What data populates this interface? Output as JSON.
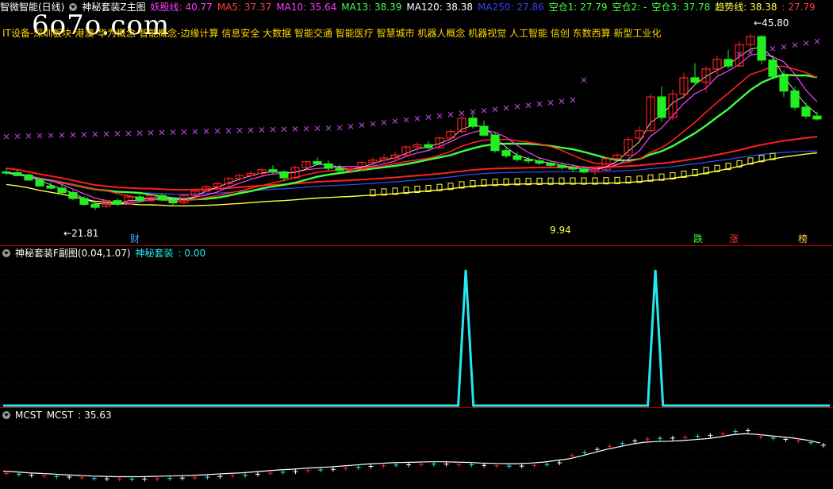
{
  "main_header": {
    "title": "智微智能(日线)",
    "indicator_name": "神秘套装Z主图",
    "items": [
      {
        "label": "妖股线",
        "value": "40.77",
        "color": "#ff3cff"
      },
      {
        "label": "MA5",
        "value": "37.37",
        "color": "#ff3c3c"
      },
      {
        "label": "MA10",
        "value": "35.64",
        "color": "#ff3cff"
      },
      {
        "label": "MA13",
        "value": "38.39",
        "color": "#4cff4c"
      },
      {
        "label": "MA120",
        "value": "38.38",
        "color": "#ffffff"
      },
      {
        "label": "MA250",
        "value": "27.86",
        "color": "#3c3cff"
      },
      {
        "label": "空仓1",
        "value": "27.79",
        "color": "#44ff44"
      },
      {
        "label": "空仓2",
        "value": "-",
        "color": "#44ff44"
      },
      {
        "label": "空仓3",
        "value": "37.78",
        "color": "#44ff44"
      },
      {
        "label": "趋势线",
        "value": "38.38",
        "color": "#ffff44"
      },
      {
        "label": "",
        "value": "27.79",
        "color": "#ff3c3c"
      }
    ]
  },
  "concepts": "IT设备-深圳板块-港澳-华为概念-智能概念-边缘计算 信息安全 大数据 智能交通 智能医疗 智慧城市 机器人概念 机器视觉 人工智能 信创 东数西算 新型工业化",
  "watermark": "6o7o.com",
  "price_labels": {
    "high": "45.80",
    "low": "21.81",
    "mid": "9.94"
  },
  "markers": {
    "cai": "财",
    "die": "跌",
    "zhang": "涨",
    "bang": "榜"
  },
  "sub1": {
    "title": "神秘套装F副图(0.04,1.07)",
    "label": "神秘套装",
    "value": "0.00"
  },
  "sub2": {
    "title": "MCST",
    "label": "MCST",
    "value": "35.63"
  },
  "colors": {
    "up": "#ff2020",
    "down": "#22ee22",
    "grid": "#7a0000",
    "cyan": "#22e8f0",
    "cross": "#b040d0",
    "ma_red": "#ff2020",
    "ma_blue": "#3050ff",
    "ma_yellow": "#ffff40",
    "ma_white": "#ffffff",
    "ma_magenta": "#ff40ff",
    "ma_green": "#40ff40"
  },
  "chart_data": [
    {
      "type": "candlestick",
      "title": "智微智能(日线)",
      "ylim": [
        18,
        48
      ],
      "candles": [
        [
          27.0,
          27.5,
          26.6,
          26.9
        ],
        [
          26.9,
          27.3,
          26.4,
          26.5
        ],
        [
          26.6,
          26.8,
          25.8,
          25.9
        ],
        [
          25.9,
          26.2,
          25.0,
          25.1
        ],
        [
          25.1,
          25.6,
          24.6,
          24.8
        ],
        [
          24.8,
          25.2,
          24.0,
          24.2
        ],
        [
          24.2,
          24.5,
          23.2,
          23.4
        ],
        [
          23.4,
          23.7,
          22.4,
          22.6
        ],
        [
          22.6,
          23.0,
          21.81,
          22.2
        ],
        [
          22.3,
          23.3,
          22.1,
          23.1
        ],
        [
          23.1,
          23.4,
          22.4,
          22.6
        ],
        [
          22.6,
          23.8,
          22.5,
          23.6
        ],
        [
          23.6,
          24.0,
          22.9,
          23.1
        ],
        [
          23.1,
          24.0,
          22.9,
          23.8
        ],
        [
          23.8,
          24.1,
          23.0,
          23.2
        ],
        [
          23.2,
          23.6,
          22.5,
          22.8
        ],
        [
          22.8,
          24.0,
          22.6,
          23.8
        ],
        [
          23.8,
          24.6,
          23.5,
          24.4
        ],
        [
          24.4,
          25.2,
          24.2,
          25.0
        ],
        [
          25.0,
          25.6,
          24.7,
          25.4
        ],
        [
          25.4,
          26.3,
          25.0,
          26.1
        ],
        [
          26.1,
          26.8,
          25.8,
          26.5
        ],
        [
          26.5,
          27.2,
          26.1,
          26.8
        ],
        [
          26.8,
          27.6,
          26.4,
          27.3
        ],
        [
          27.3,
          27.9,
          26.8,
          27.0
        ],
        [
          27.0,
          27.2,
          25.8,
          26.2
        ],
        [
          26.2,
          27.8,
          26.0,
          27.6
        ],
        [
          27.6,
          28.5,
          27.2,
          28.4
        ],
        [
          28.4,
          29.0,
          27.9,
          28.1
        ],
        [
          28.1,
          28.6,
          27.2,
          27.5
        ],
        [
          27.5,
          28.0,
          26.9,
          27.2
        ],
        [
          27.2,
          27.8,
          26.8,
          27.4
        ],
        [
          27.4,
          28.4,
          27.1,
          28.3
        ],
        [
          28.3,
          29.0,
          27.9,
          28.6
        ],
        [
          28.6,
          29.4,
          28.2,
          28.9
        ],
        [
          28.9,
          29.8,
          28.5,
          29.3
        ],
        [
          29.3,
          30.6,
          29.0,
          30.4
        ],
        [
          30.4,
          31.0,
          29.8,
          30.7
        ],
        [
          30.7,
          31.2,
          30.0,
          30.3
        ],
        [
          30.3,
          31.8,
          30.1,
          31.6
        ],
        [
          31.6,
          32.8,
          31.2,
          32.5
        ],
        [
          32.5,
          34.6,
          32.2,
          34.3
        ],
        [
          34.3,
          34.9,
          32.9,
          33.2
        ],
        [
          33.2,
          34.0,
          31.8,
          32.0
        ],
        [
          32.0,
          32.4,
          29.6,
          29.9
        ],
        [
          29.9,
          30.3,
          28.9,
          29.2
        ],
        [
          29.2,
          29.7,
          28.4,
          28.7
        ],
        [
          28.7,
          29.1,
          28.1,
          28.5
        ],
        [
          28.5,
          28.9,
          27.9,
          28.2
        ],
        [
          28.2,
          28.6,
          27.6,
          27.9
        ],
        [
          27.9,
          28.3,
          27.3,
          27.6
        ],
        [
          27.6,
          28.0,
          27.0,
          27.4
        ],
        [
          27.4,
          27.8,
          26.8,
          27.0
        ],
        [
          27.0,
          27.6,
          26.6,
          27.3
        ],
        [
          27.3,
          29.0,
          27.1,
          28.8
        ],
        [
          28.8,
          29.6,
          28.5,
          29.3
        ],
        [
          29.3,
          31.8,
          29.0,
          31.4
        ],
        [
          31.6,
          33.2,
          31.2,
          32.6
        ],
        [
          32.6,
          37.6,
          32.4,
          37.2
        ],
        [
          37.2,
          38.6,
          33.8,
          34.4
        ],
        [
          34.4,
          38.2,
          34.0,
          37.6
        ],
        [
          37.6,
          40.5,
          37.0,
          39.8
        ],
        [
          39.8,
          41.8,
          38.8,
          39.2
        ],
        [
          39.2,
          41.4,
          37.8,
          41.0
        ],
        [
          41.0,
          42.8,
          40.2,
          42.3
        ],
        [
          42.3,
          43.6,
          41.0,
          41.4
        ],
        [
          41.4,
          44.8,
          41.2,
          44.3
        ],
        [
          44.3,
          45.8,
          43.2,
          45.4
        ],
        [
          45.4,
          45.6,
          41.6,
          42.2
        ],
        [
          42.2,
          42.8,
          39.6,
          40.0
        ],
        [
          40.0,
          40.8,
          37.2,
          38.0
        ],
        [
          38.0,
          38.6,
          35.4,
          35.8
        ],
        [
          35.8,
          36.4,
          34.2,
          34.6
        ],
        [
          34.6,
          35.2,
          34.0,
          34.2
        ]
      ]
    },
    {
      "type": "line",
      "title": "神秘套装F副图",
      "ylim": [
        0,
        1.07
      ],
      "values": [
        0,
        0,
        0,
        0,
        0,
        0,
        0,
        0,
        0,
        0,
        0,
        0,
        0,
        0,
        0,
        0,
        0,
        0,
        0,
        0,
        0,
        0,
        0,
        0,
        0,
        0,
        0,
        0,
        0,
        0,
        0,
        0,
        0,
        0,
        0,
        0,
        0,
        0,
        0,
        0,
        0,
        0,
        0,
        0,
        0,
        0,
        0,
        0,
        0,
        0,
        0,
        0,
        0,
        0,
        0,
        0,
        0,
        0,
        0,
        0,
        0,
        1,
        0,
        0,
        0,
        0,
        0,
        0,
        0,
        0,
        0,
        0,
        0,
        0,
        0,
        0,
        0,
        0,
        0,
        0,
        0,
        0,
        0,
        0,
        0,
        0,
        1,
        0,
        0,
        0,
        0,
        0,
        0,
        0,
        0,
        0,
        0,
        0,
        0,
        0,
        0,
        0,
        0,
        0,
        0,
        0,
        0,
        0,
        0,
        0
      ]
    },
    {
      "type": "line",
      "title": "MCST",
      "ylim": [
        20,
        40
      ],
      "values": [
        24.5,
        24.3,
        24.0,
        23.8,
        23.6,
        23.4,
        23.2,
        23.0,
        22.9,
        22.8,
        22.8,
        22.8,
        22.9,
        23.0,
        23.1,
        23.2,
        23.4,
        23.6,
        23.8,
        24.0,
        24.3,
        24.6,
        24.9,
        25.1,
        25.4,
        25.6,
        25.8,
        26.1,
        26.4,
        26.7,
        26.9,
        27.1,
        27.2,
        27.3,
        27.4,
        27.4,
        27.3,
        27.2,
        27.0,
        26.9,
        26.8,
        26.8,
        27.0,
        27.3,
        27.8,
        28.3,
        29.2,
        30.2,
        31.2,
        32.0,
        32.8,
        33.4,
        33.6,
        33.7,
        33.9,
        34.2,
        34.5,
        35.0,
        35.7,
        36.0,
        35.8,
        35.4,
        35.0,
        34.6,
        34.0,
        33.2
      ]
    }
  ]
}
